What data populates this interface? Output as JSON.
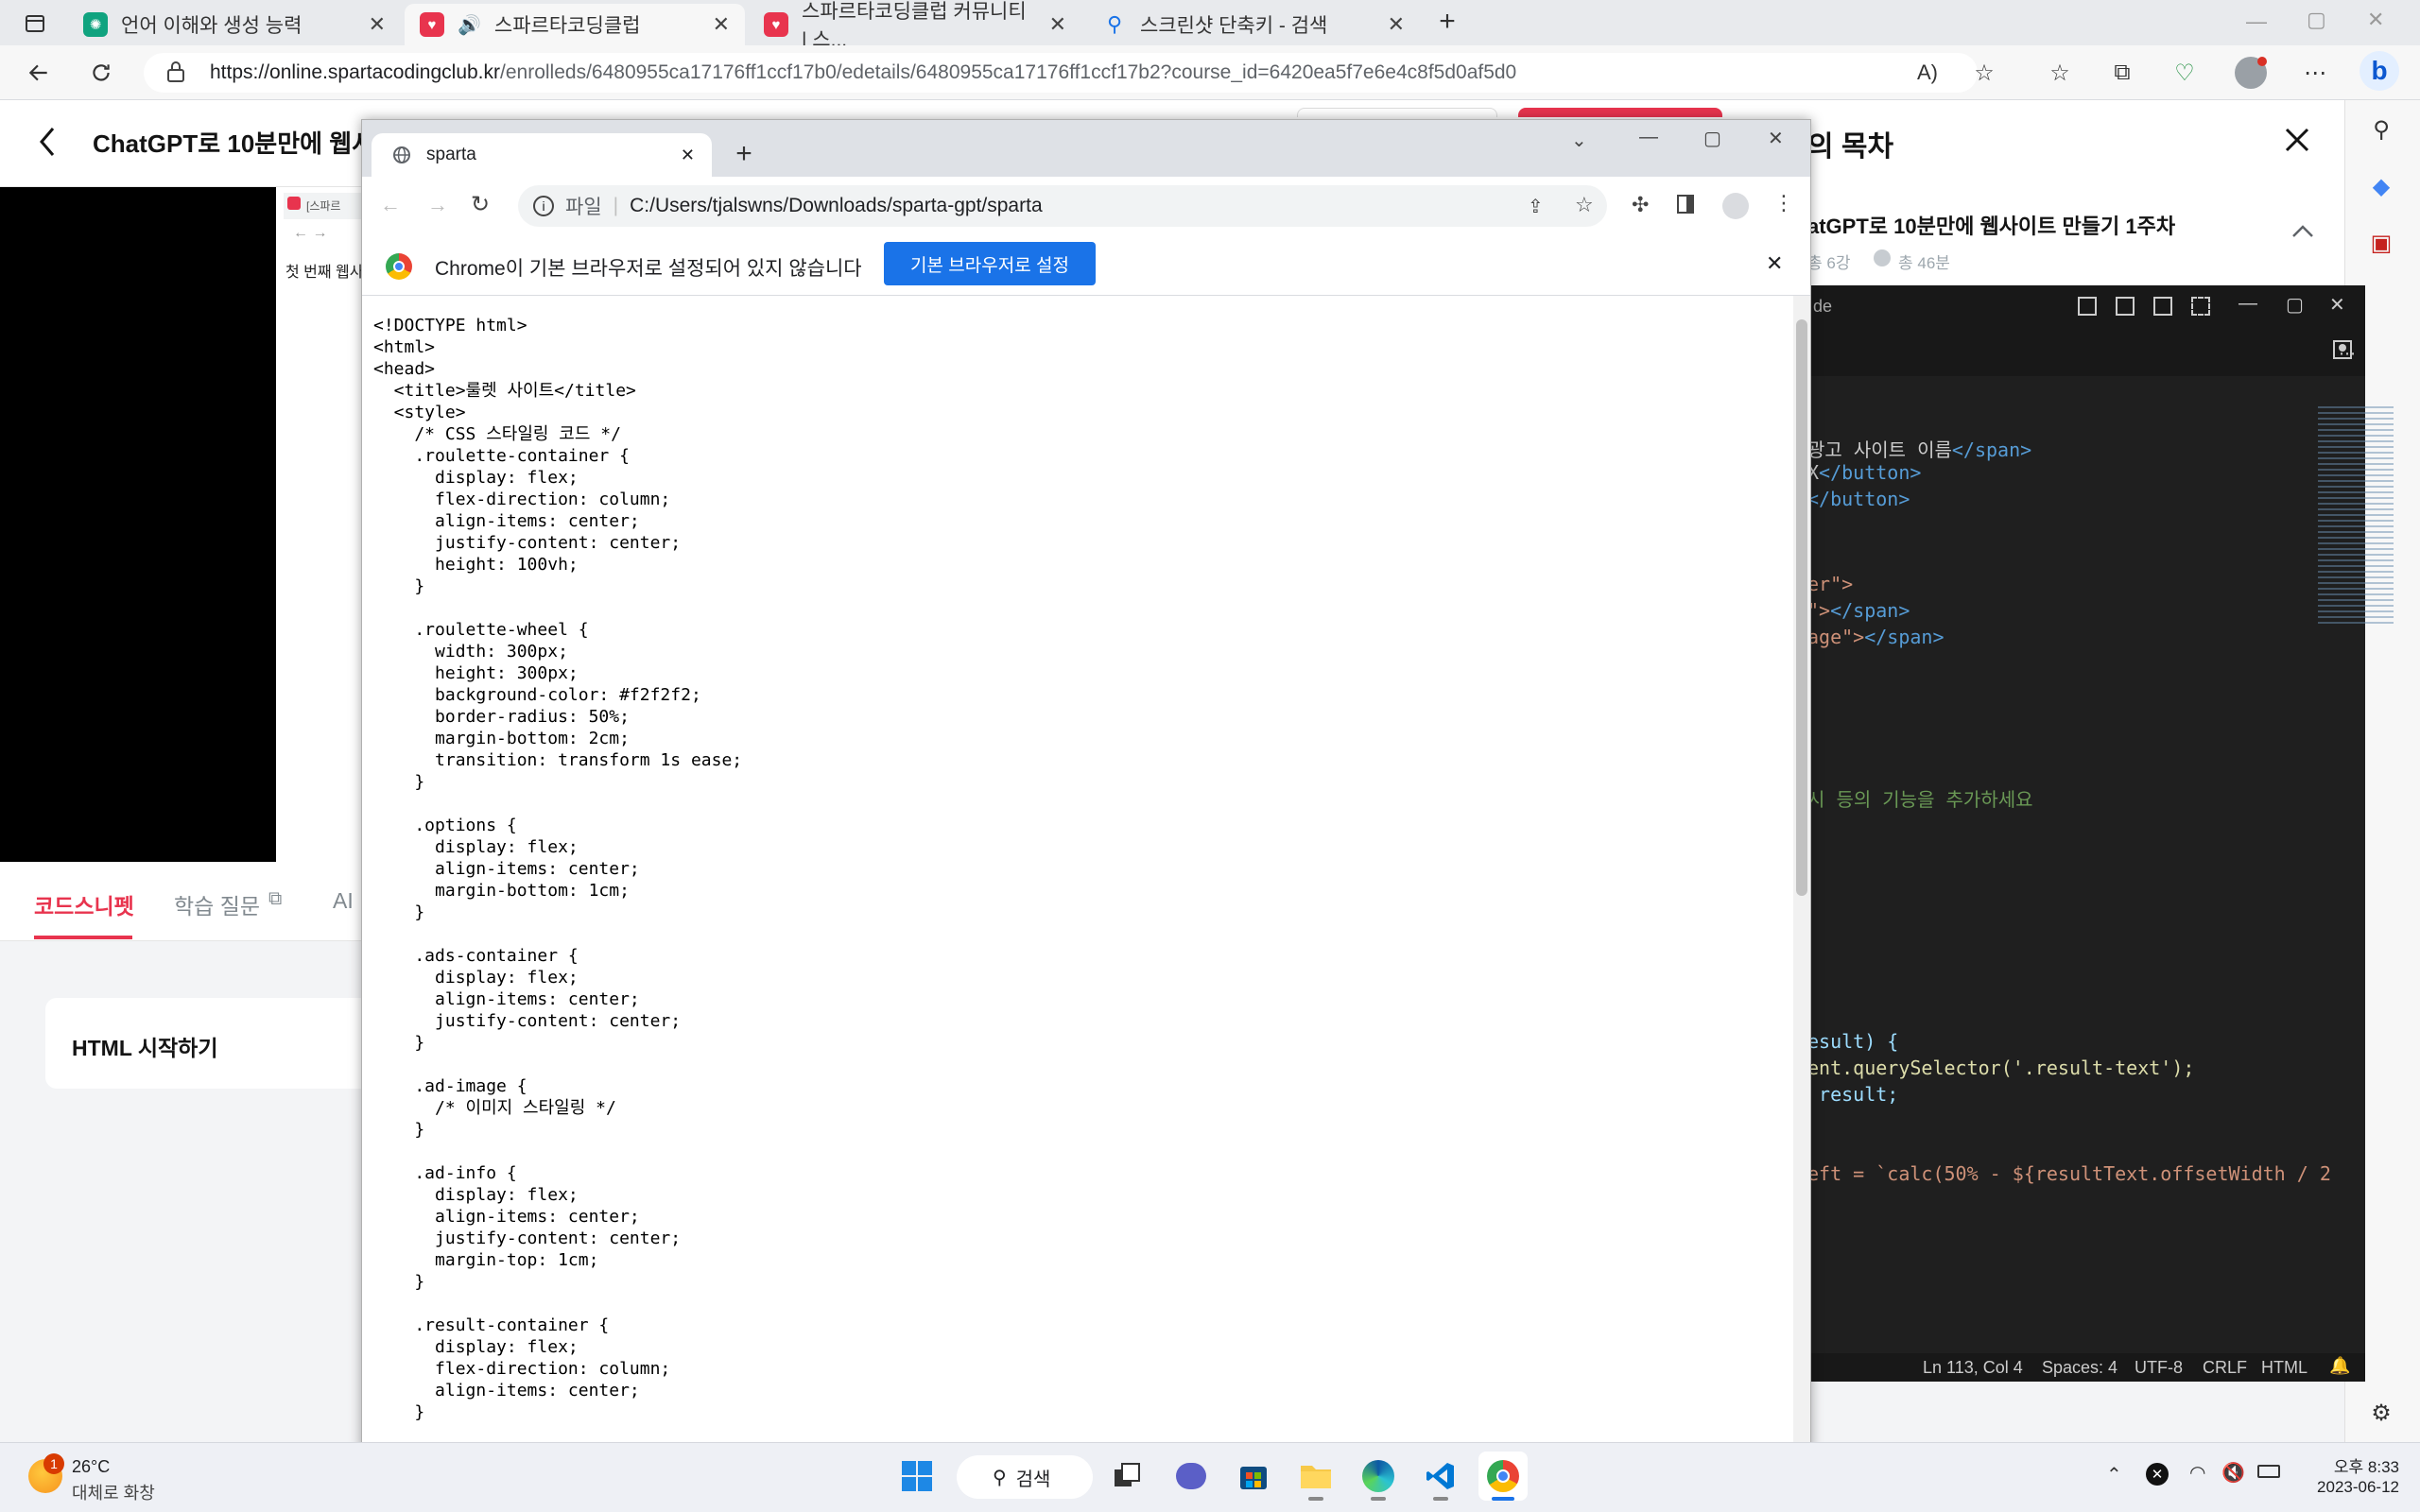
{
  "edge": {
    "tabs": [
      {
        "title": "언어 이해와 생성 능력",
        "icon_color": "#10a37f"
      },
      {
        "title": "스파르타코딩클럽",
        "icon_color": "#e8344e"
      },
      {
        "title": "스파르타코딩클럽 커뮤니티 | 스...",
        "icon_color": "#e8344e"
      },
      {
        "title": "스크린샷 단축키 - 검색",
        "icon_color": "#1a73e8"
      }
    ],
    "url_host": "https://online.spartacodingclub.kr",
    "url_path": "/enrolleds/6480955ca17176ff1ccf17b0/edetails/6480955ca17176ff1ccf17b2?course_id=6420ea5f7e6e4c8f5d0af5d0"
  },
  "page": {
    "lesson_title": "ChatGPT로 10분만에 웹사이",
    "video_thumb_label": "[스파르",
    "video_thumb_text": "첫 번째 웹사",
    "tabs": [
      "코드스니펫",
      "학습 질문",
      "AI"
    ],
    "card_title": "HTML 시작하기",
    "toc_title": "의 목차",
    "toc_course": "atGPT로 10분만에 웹사이트 만들기 1주차",
    "toc_lessons": "총 6강",
    "toc_duration": "총 46분"
  },
  "vscode": {
    "title": "de",
    "lines": [
      {
        "text": "광고 사이트 이름",
        "tail": "</span>",
        "color": "#cccccc"
      },
      {
        "text": "X",
        "tail": "</button>",
        "color": "#cccccc"
      },
      {
        "text": "",
        "tail": "</button>",
        "color": "#cccccc"
      },
      {
        "text": "er\">",
        "tail": "",
        "color": "#ce9178"
      },
      {
        "text": "\">",
        "tail": "</span>",
        "color": "#ce9178"
      },
      {
        "text": "age\">",
        "tail": "</span>",
        "color": "#ce9178"
      },
      {
        "text": "시 등의 기능을 추가하세요",
        "tail": "",
        "color": "#6a9955"
      },
      {
        "text": "esult) {",
        "tail": "",
        "color": "#9cdcfe"
      },
      {
        "text": "ent.querySelector('.result-text');",
        "tail": "",
        "color": "#dcdcaa"
      },
      {
        "text": " result;",
        "tail": "",
        "color": "#9cdcfe"
      },
      {
        "text": "eft = `calc(50% - ${resultText.offsetWidth / 2",
        "tail": "",
        "color": "#ce9178"
      }
    ],
    "status": {
      "position": "Ln 113, Col 4",
      "spaces": "Spaces: 4",
      "encoding": "UTF-8",
      "eol": "CRLF",
      "language": "HTML"
    }
  },
  "chrome": {
    "tab_title": "sparta",
    "file_label": "파일",
    "path": "C:/Users/tjalswns/Downloads/sparta-gpt/sparta",
    "infobar_text": "Chrome이 기본 브라우저로 설정되어 있지 않습니다",
    "infobar_button": "기본 브라우저로 설정",
    "source": "<!DOCTYPE html>\n<html>\n<head>\n  <title>룰렛 사이트</title>\n  <style>\n    /* CSS 스타일링 코드 */\n    .roulette-container {\n      display: flex;\n      flex-direction: column;\n      align-items: center;\n      justify-content: center;\n      height: 100vh;\n    }\n\n    .roulette-wheel {\n      width: 300px;\n      height: 300px;\n      background-color: #f2f2f2;\n      border-radius: 50%;\n      margin-bottom: 2cm;\n      transition: transform 1s ease;\n    }\n\n    .options {\n      display: flex;\n      align-items: center;\n      margin-bottom: 1cm;\n    }\n\n    .ads-container {\n      display: flex;\n      align-items: center;\n      justify-content: center;\n    }\n\n    .ad-image {\n      /* 이미지 스타일링 */\n    }\n\n    .ad-info {\n      display: flex;\n      align-items: center;\n      justify-content: center;\n      margin-top: 1cm;\n    }\n\n    .result-container {\n      display: flex;\n      flex-direction: column;\n      align-items: center;\n    }"
  },
  "taskbar": {
    "weather_temp": "26°C",
    "weather_desc": "대체로 화창",
    "weather_badge": "1",
    "search_label": "검색",
    "time": "오후 8:33",
    "date": "2023-06-12"
  }
}
